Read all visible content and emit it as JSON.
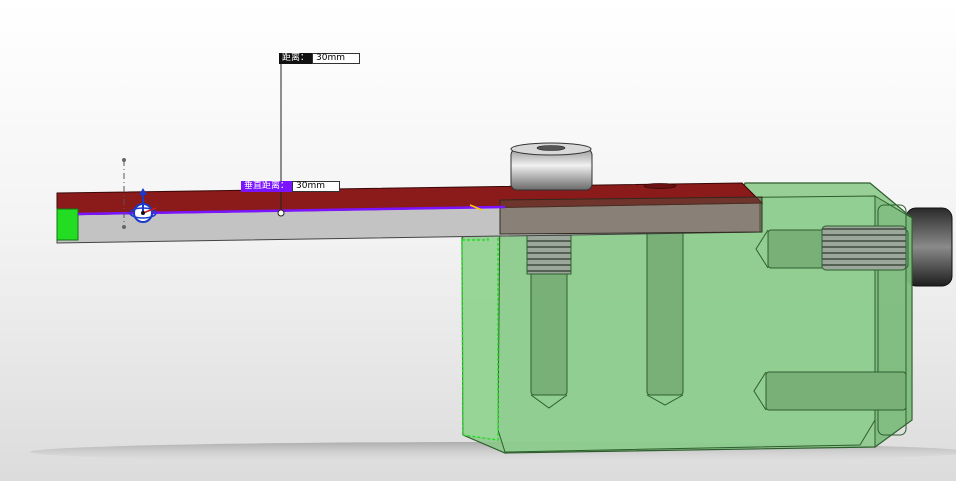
{
  "dimensions": {
    "distance": {
      "label": "距离：",
      "value": "30mm"
    },
    "vertical_distance": {
      "label": "垂直距离：",
      "value": "30mm"
    }
  },
  "colors": {
    "bar_top": "#8b1a1a",
    "bar_side": "#bfbfbf",
    "housing_fill": "#7fbf7f",
    "housing_edge": "#2e5e2e",
    "selection": "#7a14ff",
    "highlight_face": "#22dd22"
  },
  "icons": [
    "move-triad-icon"
  ]
}
